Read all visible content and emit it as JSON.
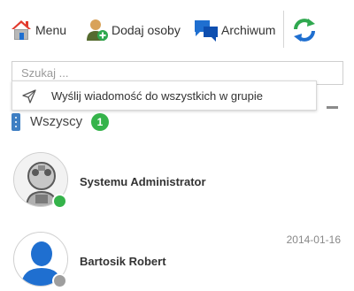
{
  "toolbar": {
    "menu_label": "Menu",
    "add_label": "Dodaj osoby",
    "archive_label": "Archiwum"
  },
  "search": {
    "placeholder": "Szukaj ...",
    "value": ""
  },
  "broadcast": {
    "label": "Wyślij wiadomość do wszystkich w grupie"
  },
  "group": {
    "name": "Wszyscy",
    "count": "1"
  },
  "contacts": [
    {
      "name": "Systemu Administrator",
      "date": "",
      "status": "online"
    },
    {
      "name": "Bartosik Robert",
      "date": "2014-01-16",
      "status": "offline"
    }
  ],
  "colors": {
    "accent": "#3f7fc3",
    "online": "#35b34a",
    "offline": "#9e9e9e",
    "home_roof": "#e23b2e",
    "refresh_green": "#2fa84f",
    "refresh_blue": "#1f6fd0"
  },
  "icons": {
    "menu": "home-icon",
    "add": "add-person-icon",
    "archive": "chat-bubbles-icon",
    "refresh": "refresh-icon",
    "broadcast": "send-icon",
    "group": "kebab-icon"
  }
}
